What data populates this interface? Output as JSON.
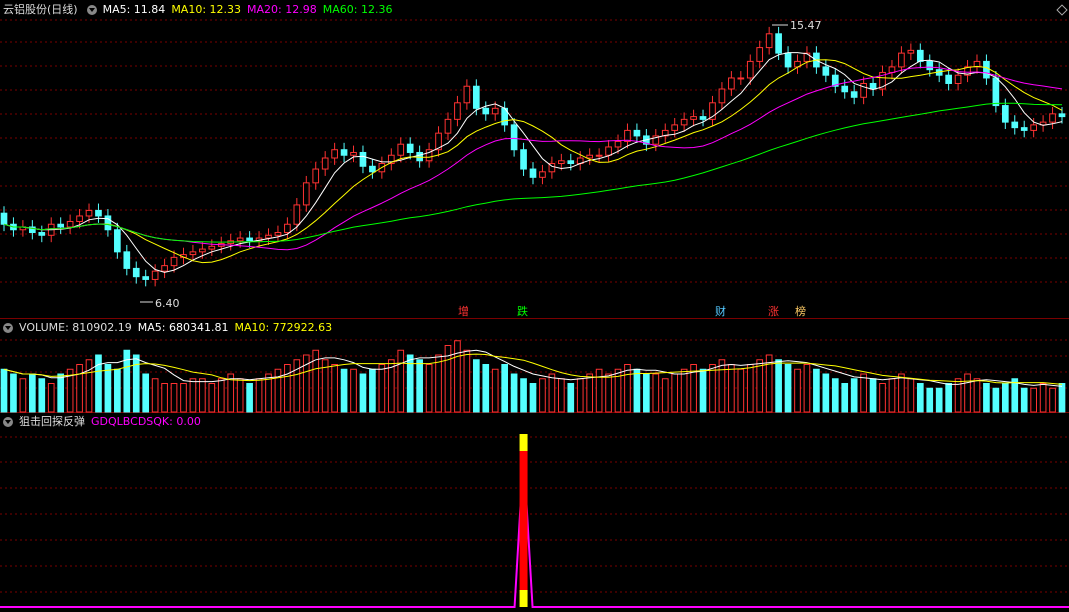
{
  "main": {
    "title": "云铝股份(日线)",
    "ma5": "MA5: 11.84",
    "ma10": "MA10: 12.33",
    "ma20": "MA20: 12.98",
    "ma60": "MA60: 12.36",
    "high_label": "15.47",
    "low_label": "6.40"
  },
  "events": [
    "增",
    "跌",
    "财",
    "涨",
    "榜"
  ],
  "volume": {
    "label": "VOLUME: 810902.19",
    "ma5": "MA5: 680341.81",
    "ma10": "MA10: 772922.63"
  },
  "indicator": {
    "name": "狙击回探反弹",
    "value": "GDQLBCDSQK: 0.00"
  },
  "colors": {
    "up": "#ff3232",
    "down": "#54ffff",
    "ma5": "#ffffff",
    "ma10": "#ffff00",
    "ma20": "#ff00ff",
    "ma60": "#00ff00",
    "grid": "#7a0000",
    "signal_red": "#ff0000",
    "signal_yellow": "#ffff00",
    "indicator_line": "#ff00ff"
  },
  "chart_data": {
    "type": "candlestick",
    "series_note": "daily OHLC prices (approximate)",
    "open": [
      9.0,
      8.6,
      8.4,
      8.5,
      8.3,
      8.2,
      8.6,
      8.5,
      8.7,
      8.9,
      9.1,
      8.9,
      8.4,
      7.6,
      7.0,
      6.7,
      6.6,
      6.9,
      7.1,
      7.4,
      7.5,
      7.6,
      7.7,
      7.8,
      7.9,
      8.0,
      8.1,
      8.0,
      8.1,
      8.2,
      8.3,
      8.6,
      9.3,
      10.1,
      10.6,
      11.0,
      11.3,
      11.1,
      11.2,
      10.7,
      10.5,
      10.8,
      11.1,
      11.5,
      11.2,
      10.9,
      11.3,
      11.9,
      12.4,
      13.0,
      13.6,
      12.8,
      12.6,
      12.8,
      12.2,
      11.3,
      10.6,
      10.3,
      10.5,
      10.8,
      10.9,
      10.8,
      11.0,
      11.1,
      11.1,
      11.4,
      11.6,
      12.0,
      11.8,
      11.5,
      11.8,
      12.0,
      12.2,
      12.4,
      12.5,
      12.4,
      13.0,
      13.5,
      13.9,
      13.9,
      14.5,
      15.0,
      15.5,
      14.8,
      14.3,
      14.5,
      14.8,
      14.3,
      14.0,
      13.6,
      13.4,
      13.2,
      13.7,
      13.5,
      14.1,
      14.3,
      14.8,
      14.9,
      14.5,
      14.2,
      14.0,
      13.7,
      14.0,
      14.3,
      14.5,
      13.9,
      12.9,
      12.3,
      12.1,
      12.0,
      12.2,
      12.3,
      12.6
    ],
    "close": [
      8.6,
      8.4,
      8.5,
      8.3,
      8.2,
      8.6,
      8.5,
      8.7,
      8.9,
      9.1,
      8.9,
      8.4,
      7.6,
      7.0,
      6.7,
      6.6,
      6.9,
      7.1,
      7.4,
      7.5,
      7.6,
      7.7,
      7.8,
      7.9,
      8.0,
      8.1,
      8.0,
      8.1,
      8.2,
      8.3,
      8.6,
      9.3,
      10.1,
      10.6,
      11.0,
      11.3,
      11.1,
      11.2,
      10.7,
      10.5,
      10.8,
      11.1,
      11.5,
      11.2,
      10.9,
      11.3,
      11.9,
      12.4,
      13.0,
      13.6,
      12.8,
      12.6,
      12.8,
      12.2,
      11.3,
      10.6,
      10.3,
      10.5,
      10.8,
      10.9,
      10.8,
      11.0,
      11.1,
      11.1,
      11.4,
      11.6,
      12.0,
      11.8,
      11.5,
      11.8,
      12.0,
      12.2,
      12.4,
      12.5,
      12.4,
      13.0,
      13.5,
      13.9,
      13.9,
      14.5,
      15.0,
      15.5,
      14.8,
      14.3,
      14.5,
      14.8,
      14.3,
      14.0,
      13.6,
      13.4,
      13.2,
      13.7,
      13.5,
      14.1,
      14.3,
      14.8,
      14.9,
      14.5,
      14.2,
      14.0,
      13.7,
      14.0,
      14.3,
      14.5,
      13.9,
      12.9,
      12.3,
      12.1,
      12.0,
      12.2,
      12.3,
      12.6,
      12.5
    ],
    "price_range": [
      6.0,
      16.0
    ],
    "volume_values": [
      9,
      8,
      7,
      8,
      7,
      6,
      8,
      9,
      10,
      11,
      12,
      10,
      9,
      13,
      12,
      8,
      7,
      6,
      6,
      6,
      7,
      7,
      6,
      7,
      8,
      7,
      6,
      7,
      8,
      9,
      10,
      11,
      12,
      13,
      11,
      10,
      9,
      9,
      8,
      9,
      10,
      11,
      13,
      12,
      11,
      10,
      12,
      14,
      15,
      13,
      11,
      10,
      9,
      10,
      8,
      7,
      6,
      7,
      8,
      7,
      6,
      7,
      8,
      9,
      8,
      9,
      10,
      9,
      8,
      8,
      7,
      8,
      9,
      10,
      9,
      10,
      11,
      10,
      9,
      10,
      11,
      12,
      11,
      10,
      9,
      10,
      9,
      8,
      7,
      6,
      7,
      8,
      7,
      6,
      7,
      8,
      7,
      6,
      5,
      5,
      6,
      7,
      8,
      7,
      6,
      5,
      6,
      7,
      5,
      5,
      6,
      5,
      6
    ],
    "volume_range": [
      0,
      16
    ],
    "signal_index": 55
  }
}
